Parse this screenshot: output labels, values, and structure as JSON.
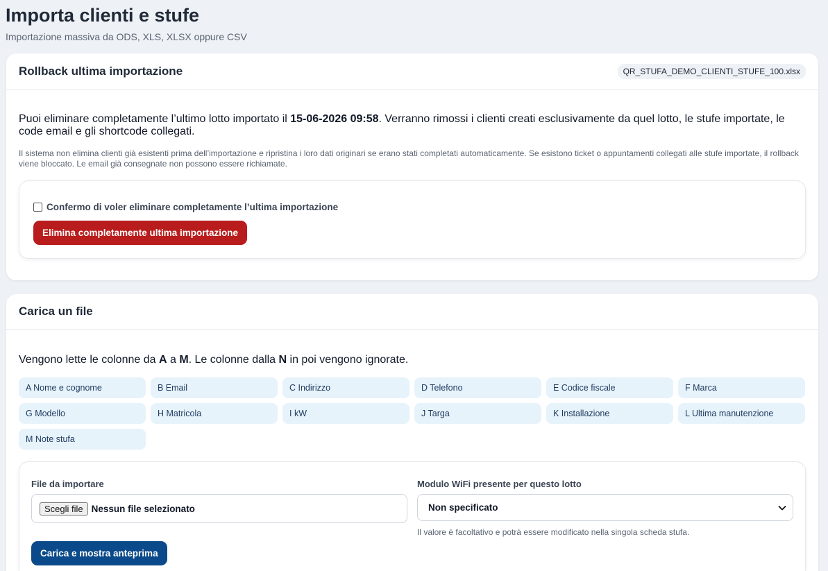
{
  "header": {
    "title": "Importa clienti e stufe",
    "subtitle": "Importazione massiva da ODS, XLS, XLSX oppure CSV"
  },
  "rollback": {
    "title": "Rollback ultima importazione",
    "file_name": "QR_STUFA_DEMO_CLIENTI_STUFE_100.xlsx",
    "lead_before": "Puoi eliminare completamente l’ultimo lotto importato il ",
    "lead_date": "15-06-2026 09:58",
    "lead_after": ". Verranno rimossi i clienti creati esclusivamente da quel lotto, le stufe importate, le code email e gli shortcode collegati.",
    "note": "Il sistema non elimina clienti già esistenti prima dell’importazione e ripristina i loro dati originari se erano stati completati automaticamente. Se esistono ticket o appuntamenti collegati alle stufe importate, il rollback viene bloccato. Le email già consegnate non possono essere richiamate.",
    "confirm_label": "Confermo di voler eliminare completamente l’ultima importazione",
    "confirm_checked": false,
    "delete_button": "Elimina completamente ultima importazione"
  },
  "upload": {
    "title": "Carica un file",
    "lead_1": "Vengono lette le colonne da ",
    "lead_a": "A",
    "lead_2": " a ",
    "lead_m": "M",
    "lead_3": ". Le colonne dalla ",
    "lead_n": "N",
    "lead_4": " in poi vengono ignorate.",
    "columns": [
      "A Nome e cognome",
      "B Email",
      "C Indirizzo",
      "D Telefono",
      "E Codice fiscale",
      "F Marca",
      "G Modello",
      "H Matricola",
      "I kW",
      "J Targa",
      "K Installazione",
      "L Ultima manutenzione",
      "M Note stufa"
    ],
    "file_label": "File da importare",
    "file_button": "Scegli file",
    "file_status": "Nessun file selezionato",
    "wifi_label": "Modulo WiFi presente per questo lotto",
    "wifi_value": "Non specificato",
    "wifi_hint": "Il valore è facoltativo e potrà essere modificato nella singola scheda stufa.",
    "submit_button": "Carica e mostra anteprima"
  },
  "colors": {
    "danger": "#b91c1c",
    "primary": "#0b4a8a",
    "chip": "#e7f3fb"
  },
  "icons": {
    "select_chevron": "chevron-down-icon"
  }
}
